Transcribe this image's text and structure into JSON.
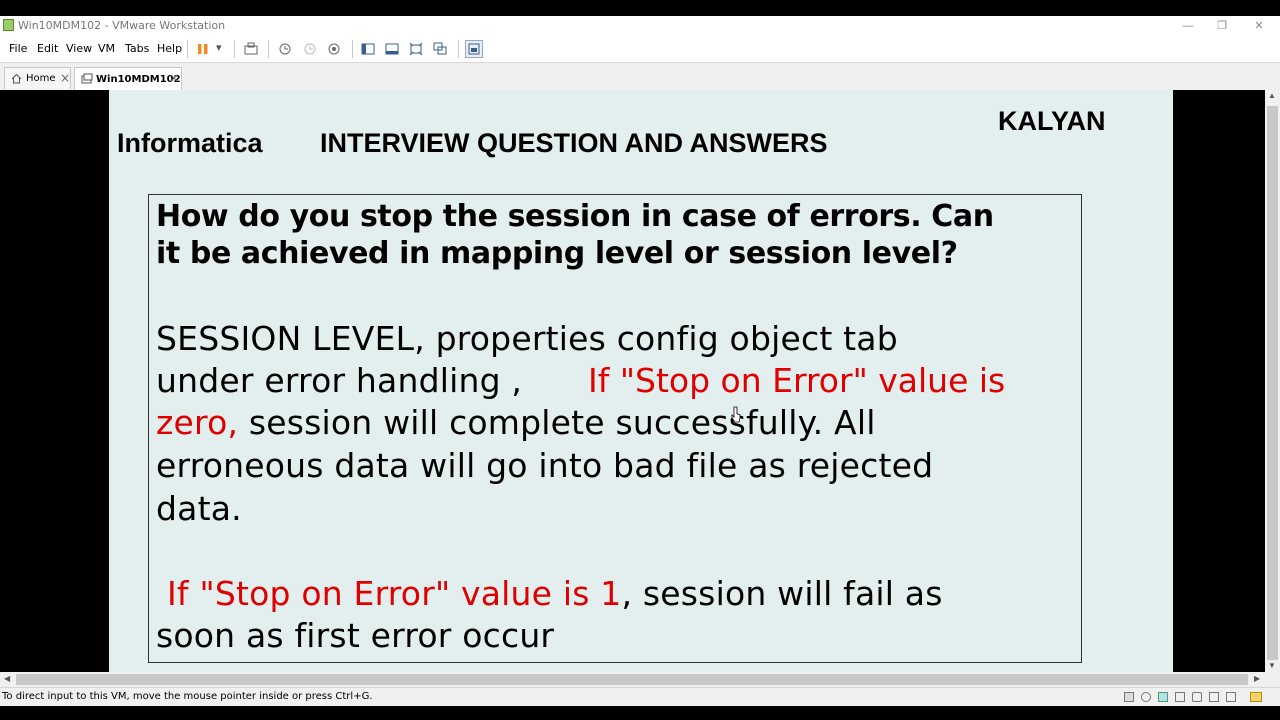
{
  "window": {
    "title": "Win10MDM102 - VMware Workstation",
    "minimize_glyph": "—",
    "restore_glyph": "❐",
    "close_glyph": "✕"
  },
  "menu": {
    "items": [
      "File",
      "Edit",
      "View",
      "VM",
      "Tabs",
      "Help"
    ],
    "dropdown_glyph": "▾"
  },
  "tabs": [
    {
      "label": "Home",
      "close": "×"
    },
    {
      "label": "Win10MDM102",
      "close": "×"
    }
  ],
  "slide": {
    "brand": "Informatica",
    "heading": "INTERVIEW QUESTION AND ANSWERS",
    "author": "KALYAN",
    "question": {
      "line1": "How do you stop the session in case of errors. Can",
      "line2": "it be achieved in mapping level or session level?"
    },
    "answer": {
      "l1": "SESSION LEVEL, properties config object tab",
      "l2a": "under error handling ,",
      "l2b": "If \"Stop on Error\" value is",
      "l3a": "zero,",
      "l3b": " session will complete successfully. All",
      "l4": "erroneous data will go into bad file as rejected",
      "l5": "data.",
      "l6a": "If \"Stop on Error\" value is 1",
      "l6b": ", session will fail as",
      "l7": "soon as first error occur"
    }
  },
  "scroll": {
    "up": "▲",
    "down": "▼",
    "left": "◀",
    "right": "▶"
  },
  "status": {
    "text": "To direct input to this VM, move the mouse pointer inside or press Ctrl+G."
  },
  "colors": {
    "slide_bg": "#e3eeee",
    "highlight": "#e00000",
    "pause": "#f08a24"
  }
}
